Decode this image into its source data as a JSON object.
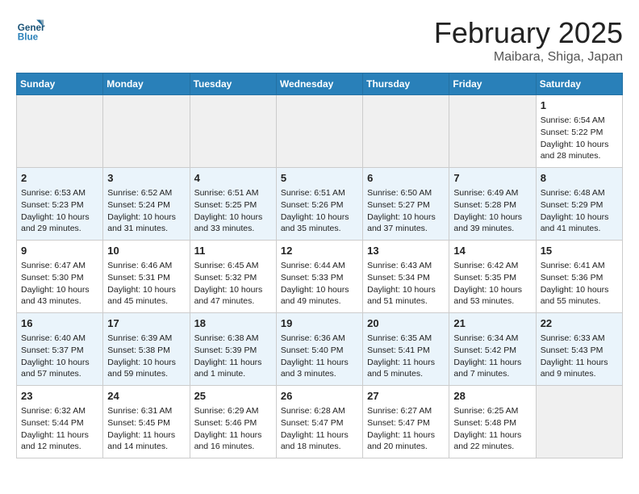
{
  "header": {
    "logo_line1": "General",
    "logo_line2": "Blue",
    "title": "February 2025",
    "subtitle": "Maibara, Shiga, Japan"
  },
  "days_of_week": [
    "Sunday",
    "Monday",
    "Tuesday",
    "Wednesday",
    "Thursday",
    "Friday",
    "Saturday"
  ],
  "weeks": [
    [
      {
        "day": "",
        "empty": true
      },
      {
        "day": "",
        "empty": true
      },
      {
        "day": "",
        "empty": true
      },
      {
        "day": "",
        "empty": true
      },
      {
        "day": "",
        "empty": true
      },
      {
        "day": "",
        "empty": true
      },
      {
        "day": "1",
        "sunrise": "Sunrise: 6:54 AM",
        "sunset": "Sunset: 5:22 PM",
        "daylight": "Daylight: 10 hours and 28 minutes."
      }
    ],
    [
      {
        "day": "2",
        "sunrise": "Sunrise: 6:53 AM",
        "sunset": "Sunset: 5:23 PM",
        "daylight": "Daylight: 10 hours and 29 minutes."
      },
      {
        "day": "3",
        "sunrise": "Sunrise: 6:52 AM",
        "sunset": "Sunset: 5:24 PM",
        "daylight": "Daylight: 10 hours and 31 minutes."
      },
      {
        "day": "4",
        "sunrise": "Sunrise: 6:51 AM",
        "sunset": "Sunset: 5:25 PM",
        "daylight": "Daylight: 10 hours and 33 minutes."
      },
      {
        "day": "5",
        "sunrise": "Sunrise: 6:51 AM",
        "sunset": "Sunset: 5:26 PM",
        "daylight": "Daylight: 10 hours and 35 minutes."
      },
      {
        "day": "6",
        "sunrise": "Sunrise: 6:50 AM",
        "sunset": "Sunset: 5:27 PM",
        "daylight": "Daylight: 10 hours and 37 minutes."
      },
      {
        "day": "7",
        "sunrise": "Sunrise: 6:49 AM",
        "sunset": "Sunset: 5:28 PM",
        "daylight": "Daylight: 10 hours and 39 minutes."
      },
      {
        "day": "8",
        "sunrise": "Sunrise: 6:48 AM",
        "sunset": "Sunset: 5:29 PM",
        "daylight": "Daylight: 10 hours and 41 minutes."
      }
    ],
    [
      {
        "day": "9",
        "sunrise": "Sunrise: 6:47 AM",
        "sunset": "Sunset: 5:30 PM",
        "daylight": "Daylight: 10 hours and 43 minutes."
      },
      {
        "day": "10",
        "sunrise": "Sunrise: 6:46 AM",
        "sunset": "Sunset: 5:31 PM",
        "daylight": "Daylight: 10 hours and 45 minutes."
      },
      {
        "day": "11",
        "sunrise": "Sunrise: 6:45 AM",
        "sunset": "Sunset: 5:32 PM",
        "daylight": "Daylight: 10 hours and 47 minutes."
      },
      {
        "day": "12",
        "sunrise": "Sunrise: 6:44 AM",
        "sunset": "Sunset: 5:33 PM",
        "daylight": "Daylight: 10 hours and 49 minutes."
      },
      {
        "day": "13",
        "sunrise": "Sunrise: 6:43 AM",
        "sunset": "Sunset: 5:34 PM",
        "daylight": "Daylight: 10 hours and 51 minutes."
      },
      {
        "day": "14",
        "sunrise": "Sunrise: 6:42 AM",
        "sunset": "Sunset: 5:35 PM",
        "daylight": "Daylight: 10 hours and 53 minutes."
      },
      {
        "day": "15",
        "sunrise": "Sunrise: 6:41 AM",
        "sunset": "Sunset: 5:36 PM",
        "daylight": "Daylight: 10 hours and 55 minutes."
      }
    ],
    [
      {
        "day": "16",
        "sunrise": "Sunrise: 6:40 AM",
        "sunset": "Sunset: 5:37 PM",
        "daylight": "Daylight: 10 hours and 57 minutes."
      },
      {
        "day": "17",
        "sunrise": "Sunrise: 6:39 AM",
        "sunset": "Sunset: 5:38 PM",
        "daylight": "Daylight: 10 hours and 59 minutes."
      },
      {
        "day": "18",
        "sunrise": "Sunrise: 6:38 AM",
        "sunset": "Sunset: 5:39 PM",
        "daylight": "Daylight: 11 hours and 1 minute."
      },
      {
        "day": "19",
        "sunrise": "Sunrise: 6:36 AM",
        "sunset": "Sunset: 5:40 PM",
        "daylight": "Daylight: 11 hours and 3 minutes."
      },
      {
        "day": "20",
        "sunrise": "Sunrise: 6:35 AM",
        "sunset": "Sunset: 5:41 PM",
        "daylight": "Daylight: 11 hours and 5 minutes."
      },
      {
        "day": "21",
        "sunrise": "Sunrise: 6:34 AM",
        "sunset": "Sunset: 5:42 PM",
        "daylight": "Daylight: 11 hours and 7 minutes."
      },
      {
        "day": "22",
        "sunrise": "Sunrise: 6:33 AM",
        "sunset": "Sunset: 5:43 PM",
        "daylight": "Daylight: 11 hours and 9 minutes."
      }
    ],
    [
      {
        "day": "23",
        "sunrise": "Sunrise: 6:32 AM",
        "sunset": "Sunset: 5:44 PM",
        "daylight": "Daylight: 11 hours and 12 minutes."
      },
      {
        "day": "24",
        "sunrise": "Sunrise: 6:31 AM",
        "sunset": "Sunset: 5:45 PM",
        "daylight": "Daylight: 11 hours and 14 minutes."
      },
      {
        "day": "25",
        "sunrise": "Sunrise: 6:29 AM",
        "sunset": "Sunset: 5:46 PM",
        "daylight": "Daylight: 11 hours and 16 minutes."
      },
      {
        "day": "26",
        "sunrise": "Sunrise: 6:28 AM",
        "sunset": "Sunset: 5:47 PM",
        "daylight": "Daylight: 11 hours and 18 minutes."
      },
      {
        "day": "27",
        "sunrise": "Sunrise: 6:27 AM",
        "sunset": "Sunset: 5:47 PM",
        "daylight": "Daylight: 11 hours and 20 minutes."
      },
      {
        "day": "28",
        "sunrise": "Sunrise: 6:25 AM",
        "sunset": "Sunset: 5:48 PM",
        "daylight": "Daylight: 11 hours and 22 minutes."
      },
      {
        "day": "",
        "empty": true
      }
    ]
  ]
}
